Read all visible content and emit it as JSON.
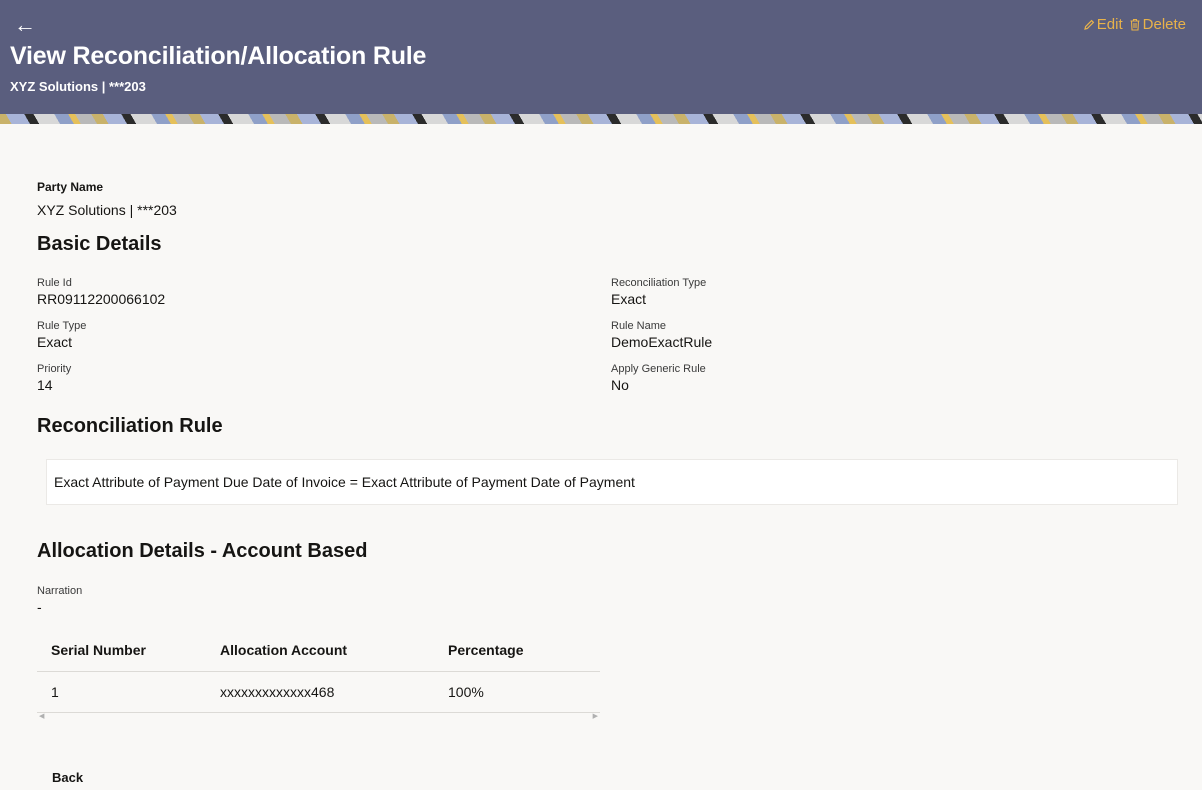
{
  "header": {
    "back_icon": "left-arrow-icon",
    "title": "View Reconciliation/Allocation Rule",
    "subtitle": "XYZ Solutions | ***203",
    "edit_label": "Edit",
    "delete_label": "Delete",
    "background_color": "#5a5e7e",
    "action_color": "#e8b24a"
  },
  "party": {
    "label": "Party Name",
    "value": "XYZ Solutions | ***203"
  },
  "basic_details": {
    "title": "Basic Details",
    "fields": [
      {
        "label": "Rule Id",
        "value": "RR09112200066102"
      },
      {
        "label": "Reconciliation Type",
        "value": "Exact"
      },
      {
        "label": "Rule Type",
        "value": "Exact"
      },
      {
        "label": "Rule Name",
        "value": "DemoExactRule"
      },
      {
        "label": "Priority",
        "value": "14"
      },
      {
        "label": "Apply Generic Rule",
        "value": "No"
      }
    ]
  },
  "reconciliation_rule": {
    "title": "Reconciliation Rule",
    "text": "Exact Attribute of Payment Due Date of Invoice = Exact Attribute of Payment Date of Payment"
  },
  "allocation": {
    "title": "Allocation Details - Account Based",
    "narration_label": "Narration",
    "narration_value": "-",
    "columns": [
      "Serial Number",
      "Allocation Account",
      "Percentage"
    ],
    "rows": [
      [
        "1",
        "xxxxxxxxxxxxx468",
        "100%"
      ]
    ]
  },
  "footer": {
    "back_label": "Back"
  }
}
